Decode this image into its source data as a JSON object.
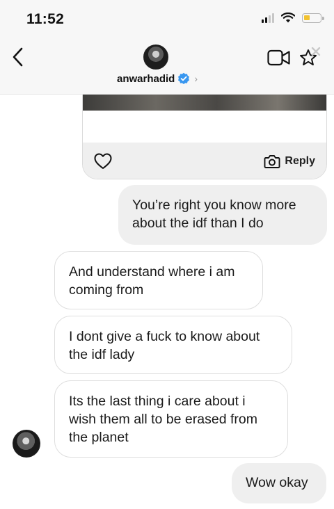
{
  "status_bar": {
    "time": "11:52"
  },
  "header": {
    "username": "anwarhadid",
    "verified_icon": "verified-badge-icon",
    "back_icon": "chevron-left-icon",
    "video_icon": "video-camera-icon",
    "star_icon": "star-icon"
  },
  "shared_post": {
    "reply_label": "Reply"
  },
  "messages": [
    {
      "from": "me",
      "text": "You’re right you know more about the idf than I do"
    },
    {
      "from": "them",
      "text": "And understand where i am coming from"
    },
    {
      "from": "them",
      "text": "I dont give a fuck to know about the idf lady"
    },
    {
      "from": "them",
      "text": "Its the last thing i care about i wish them all to be erased from the planet"
    },
    {
      "from": "me",
      "text": "Wow okay"
    }
  ],
  "colors": {
    "header_bg": "#f7f7f7",
    "sent_bubble": "#efefef",
    "received_bubble_border": "#dedede",
    "verified_blue": "#3897f0",
    "battery_yellow": "#f2c230"
  }
}
